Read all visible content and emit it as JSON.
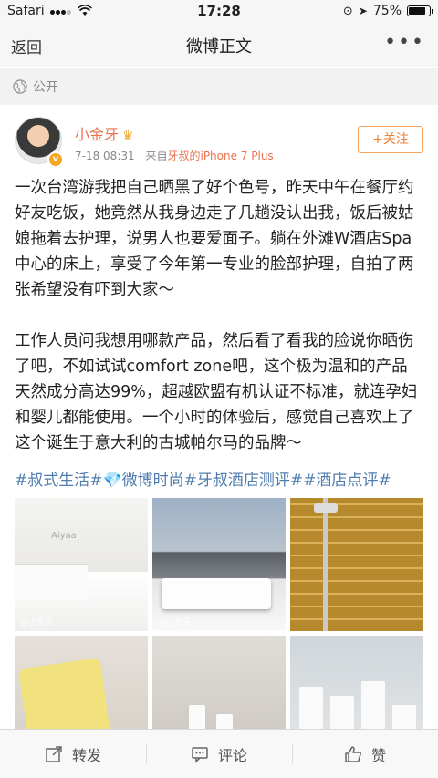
{
  "status_bar": {
    "carrier": "Safari",
    "time": "17:28",
    "battery_percent": "75%"
  },
  "nav": {
    "back_label": "返回",
    "title": "微博正文",
    "more_label": "•••"
  },
  "visibility": {
    "label": "公开"
  },
  "post": {
    "author": "小金牙",
    "verified_badge": "v",
    "time": "7-18 08:31",
    "source_prefix": "来自",
    "source": "牙叔的iPhone 7 Plus",
    "follow_label": "+关注",
    "paragraphs": [
      "一次台湾游我把自己晒黑了好个色号，昨天中午在餐厅约好友吃饭，她竟然从我身边走了几趟没认出我，饭后被姑娘拖着去护理，说男人也要爱面子。躺在外滩W酒店Spa中心的床上，享受了今年第一专业的脸部护理，自拍了两张希望没有吓到大家～",
      "工作人员问我想用哪款产品，然后看了看我的脸说你晒伤了吧，不如试试comfort zone吧，这个极为温和的产品天然成分高达99%，超越欧盟有机认证不标准，就连孕妇和婴儿都能使用。一个小时的体验后，感觉自己喜欢上了这个诞生于意大利的古城帕尔马的品牌～"
    ],
    "hashtags": "#叔式生活#💎微博时尚#牙叔酒店测评##酒店点评#",
    "images": [
      {
        "watermark": "@小金牙",
        "brand": "Aiyaa"
      },
      {
        "watermark": "@小金牙"
      },
      {
        "watermark": ""
      },
      {
        "watermark": ""
      },
      {
        "watermark": ""
      },
      {
        "watermark": ""
      }
    ]
  },
  "toolbar": {
    "repost_label": "转发",
    "comment_label": "评论",
    "like_label": "赞"
  },
  "colors": {
    "accent_orange": "#eb7350",
    "link_blue": "#507daf"
  }
}
